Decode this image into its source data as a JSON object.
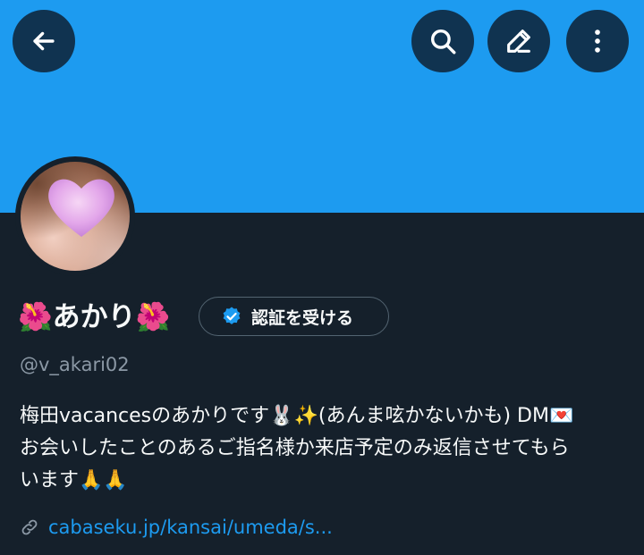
{
  "header": {
    "back_icon": "arrow-left-icon",
    "search_icon": "search-icon",
    "edit_icon": "pencil-icon",
    "more_icon": "more-vertical-icon",
    "banner_color": "#1d9bf0"
  },
  "profile": {
    "display_name": "🌺あかり🌺",
    "verify_button_label": "認証を受ける",
    "verify_icon": "verified-badge-icon",
    "handle": "@v_akari02",
    "bio_lines": [
      "梅田vacancesのあかりです🐰✨(あんま呟かないかも) DM💌",
      "お会いしたことのあるご指名様か来店予定のみ返信させてもら",
      "います🙏🙏"
    ],
    "link_icon": "link-icon",
    "link_text": "cabaseku.jp/kansai/umeda/s..."
  },
  "colors": {
    "background": "#15202b",
    "accent": "#1d9bf0",
    "secondary_text": "#8b98a5"
  }
}
